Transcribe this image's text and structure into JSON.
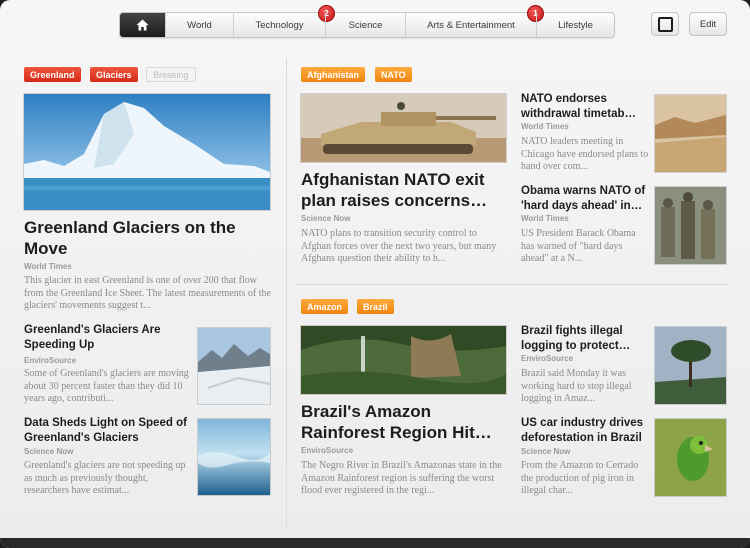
{
  "nav": {
    "tabs": [
      {
        "label": "",
        "icon": "home-icon"
      },
      {
        "label": "World"
      },
      {
        "label": "Technology",
        "badge": "2"
      },
      {
        "label": "Science"
      },
      {
        "label": "Arts & Entertainment",
        "badge": "1"
      },
      {
        "label": "Lifestyle"
      }
    ],
    "edit_label": "Edit"
  },
  "colors": {
    "tag_red": "#e03d28",
    "tag_orange": "#f7941d",
    "badge": "#d42020"
  },
  "greenland": {
    "tags": [
      "Greenland",
      "Glaciers",
      "Breaking"
    ],
    "main": {
      "headline": "Greenland Glaciers on the Move",
      "source": "World Times",
      "summary": "This glacier in east Greenland is one of over 200 that flow from the Greenland Ice Sheet. The latest measurements of the glaciers' movements suggest t..."
    },
    "items": [
      {
        "headline": "Greenland's Glaciers Are Speeding Up",
        "source": "EnviroSource",
        "summary": "Some of Greenland's glaciers are moving about 30 percent faster than they did 10 years ago, contributi..."
      },
      {
        "headline": "Data Sheds Light on Speed of Greenland's Glaciers",
        "source": "Science Now",
        "summary": "Greenland's glaciers are not speeding up as much as previously thought, researchers have estimat..."
      }
    ]
  },
  "afghanistan": {
    "tags": [
      "Afghanistan",
      "NATO"
    ],
    "main": {
      "headline": "Afghanistan NATO exit plan raises concerns…",
      "source": "Science Now",
      "summary": "NATO plans to transition security control to Afghan forces over the next two years, but many Afghans question their ability to h..."
    },
    "items": [
      {
        "headline": "NATO endorses withdrawal timetab…",
        "source": "World Times",
        "summary": "NATO leaders meeting in Chicago have endorsed plans to hand over com..."
      },
      {
        "headline": "Obama warns NATO of 'hard days ahead' in…",
        "source": "World Times",
        "summary": "US President Barack Obama has warned of \"hard days ahead\" at a N..."
      }
    ]
  },
  "amazon": {
    "tags": [
      "Amazon",
      "Brazil"
    ],
    "main": {
      "headline": "Brazil's Amazon Rainforest Region Hit…",
      "source": "EnviroSource",
      "summary": "The Negro River in Brazil's Amazonas state in the Amazon Rainforest region is suffering the worst flood ever registered in the regi..."
    },
    "items": [
      {
        "headline": "Brazil fights illegal logging to protect…",
        "source": "EnviroSource",
        "summary": "Brazil said Monday it was working hard to stop illegal logging in Amaz..."
      },
      {
        "headline": "US car industry drives deforestation in Brazil",
        "source": "Science Now",
        "summary": "From the Amazon to Cerrado the production of pig iron in illegal char..."
      }
    ]
  }
}
